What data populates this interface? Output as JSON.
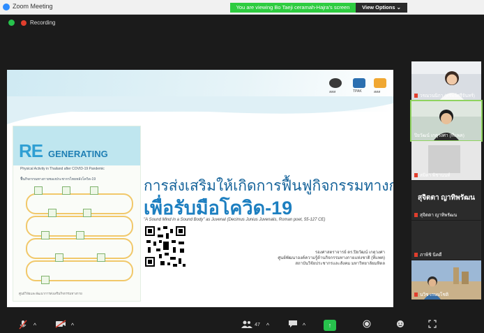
{
  "titlebar": {
    "app_title": "Zoom Meeting",
    "share_banner": "You are viewing Bo Taeji ceramah-Hajra's screen",
    "view_options": "View Options ⌄"
  },
  "status": {
    "recording_label": "Recording"
  },
  "slide": {
    "top_logo_labels": [
      "สสส",
      "TPAK",
      "สสส"
    ],
    "book": {
      "re": "RE",
      "generating": "GENERATING",
      "subtitle": "Physical Activity in Thailand after COVID-19 Pandemic",
      "thai_subtitle": "ฟื้นกิจกรรมทางกายของประชากรไทยหลังโควิด-19",
      "footer": "ศูนย์วิจัยและพัฒนาการส่งเสริมกิจกรรมทางกาย"
    },
    "title_line1": "การส่งเสริมให้เกิดการฟื้นฟูกิจกรรมทางกาย",
    "title_line2": "เพื่อรับมือโควิด-19",
    "quote": "\"A Sound Mind in a Sound Body\" as Juvenal (Decimus Junius Juvenalis, Roman poet, 55-127 CE)",
    "credit_lines": [
      "รองศาสตราจารย์ ดร.ปิยวัฒน์ เกตุวงศา",
      "ศูนย์พัฒนาองค์ความรู้ด้านกิจกรรมทางกายแห่งชาติ (ทีแพค)",
      "สถาบันวิจัยประชากรและสังคม มหาวิทยาลัยมหิดล"
    ]
  },
  "participants": [
    {
      "name": "วรณวนนิกา (ทรัพย์ศรีจันทร์)",
      "muted": true,
      "video": true,
      "active": false
    },
    {
      "name": "ปิยวัฒน์ เกตุวงศา (ทีแพค)",
      "muted": false,
      "video": true,
      "active": true
    },
    {
      "name": "สมิดา พิชานนท์",
      "muted": true,
      "video": false,
      "active": false
    },
    {
      "name": "สุจิตตา ญาทิพรัฒน",
      "muted": true,
      "video": false,
      "active": false
    },
    {
      "name": "ภาพิชิ นิคดี",
      "muted": true,
      "video": false,
      "active": false
    },
    {
      "name": "นวิช เกษมโชติ",
      "muted": true,
      "video": true,
      "active": false
    }
  ],
  "participant_big_name": "สุจิตตา ญาทิพรัฒน",
  "toolbar": {
    "mic_caret": "^",
    "video_caret": "^",
    "participants_count": "47",
    "participants_caret": "^",
    "chat_caret": "^",
    "share_icon_label": "↑"
  },
  "colors": {
    "accent": "#2d8cff",
    "share_green": "#27c24c",
    "title_blue": "#15639a"
  }
}
